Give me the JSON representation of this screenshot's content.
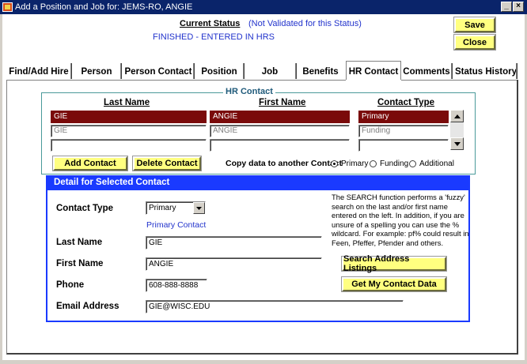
{
  "window": {
    "title": "Add a Position and Job for: JEMS-RO, ANGIE",
    "minimize_glyph": "_",
    "close_glyph": "×"
  },
  "status": {
    "label": "Current Status",
    "note": "(Not Validated for this Status)",
    "value": "FINISHED - ENTERED IN HRS"
  },
  "actions": {
    "save": "Save",
    "close": "Close"
  },
  "tabs": [
    {
      "label": "Find/Add Hire"
    },
    {
      "label": "Person"
    },
    {
      "label": "Person Contact"
    },
    {
      "label": "Position"
    },
    {
      "label": "Job"
    },
    {
      "label": "Benefits"
    },
    {
      "label": "HR Contact",
      "active": true
    },
    {
      "label": "Comments"
    },
    {
      "label": "Status History"
    }
  ],
  "hr_contact": {
    "legend": "HR Contact",
    "columns": {
      "last": "Last Name",
      "first": "First Name",
      "type": "Contact Type"
    },
    "rows": [
      {
        "last": "GIE",
        "first": "ANGIE",
        "type": "Primary"
      },
      {
        "last": "GIE",
        "first": "ANGIE",
        "type": "Funding"
      },
      {
        "last": "",
        "first": "",
        "type": ""
      }
    ],
    "add_button": "Add Contact",
    "delete_button": "Delete Contact",
    "copy_label": "Copy data to another Contact",
    "copy_options": [
      {
        "label": "Primary",
        "selected": true
      },
      {
        "label": "Funding",
        "selected": false
      },
      {
        "label": "Additional",
        "selected": false
      }
    ]
  },
  "detail": {
    "header": "Detail for Selected Contact",
    "contact_type_label": "Contact Type",
    "contact_type_value": "Primary",
    "contact_type_note": "Primary Contact",
    "last_name_label": "Last Name",
    "last_name_value": "GIE",
    "first_name_label": "First Name",
    "first_name_value": "ANGIE",
    "phone_label": "Phone",
    "phone_value": "608-888-8888",
    "email_label": "Email Address",
    "email_value": "GIE@WISC.EDU",
    "search_help": "The SEARCH function performs a 'fuzzy' search on the last and/or first name entered on the left. In addition, if you are unsure of a spelling you can use the % wildcard. For example: pf% could result in Feen, Pfeffer, Pfender and others.",
    "search_address_button": "Search Address Listings",
    "get_contact_button": "Get My Contact Data"
  }
}
